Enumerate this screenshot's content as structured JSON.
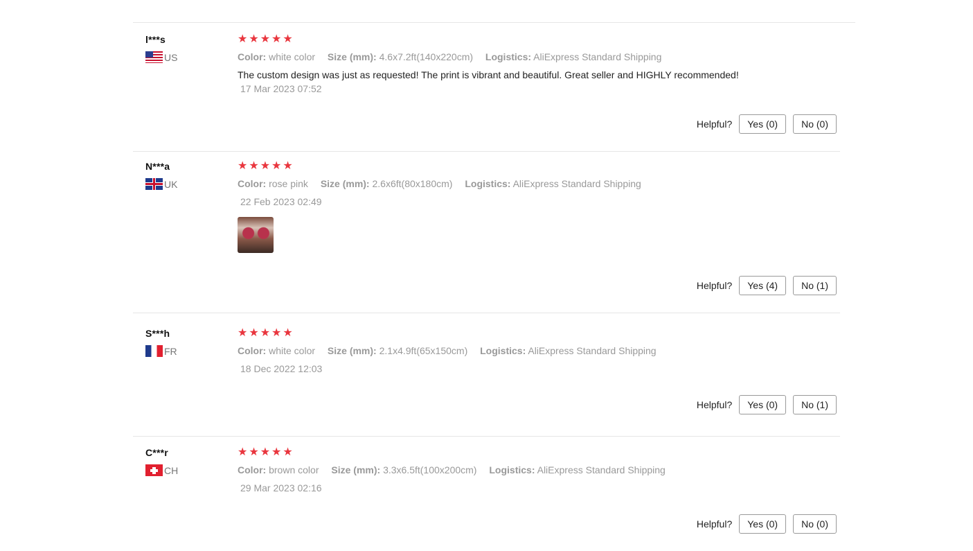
{
  "labels": {
    "color": "Color:",
    "size": "Size (mm):",
    "logistics": "Logistics:",
    "helpful": "Helpful?"
  },
  "colors": {
    "star": "#e9363e",
    "divider": "#e6e6e6"
  },
  "rating_max": 5,
  "reviews": [
    {
      "user": "l***s",
      "country": "US",
      "flag_icon": "us-flag-icon",
      "stars": 5,
      "color_value": "white color",
      "size_value": "4.6x7.2ft(140x220cm)",
      "logistics_value": "AliExpress Standard Shipping",
      "text": "The custom design was just as requested! The print is vibrant and beautiful. Great seller and HIGHLY recommended!",
      "date": "17 Mar 2023 07:52",
      "yes_label": "Yes (0)",
      "no_label": "No (0)"
    },
    {
      "user": "N***a",
      "country": "UK",
      "flag_icon": "uk-flag-icon",
      "stars": 5,
      "color_value": "rose pink",
      "size_value": "2.6x6ft(80x180cm)",
      "logistics_value": "AliExpress Standard Shipping",
      "date": "22 Feb 2023 02:49",
      "has_photo": true,
      "yes_label": "Yes (4)",
      "no_label": "No (1)"
    },
    {
      "user": "S***h",
      "country": "FR",
      "flag_icon": "fr-flag-icon",
      "stars": 5,
      "color_value": "white color",
      "size_value": "2.1x4.9ft(65x150cm)",
      "logistics_value": "AliExpress Standard Shipping",
      "date": "18 Dec 2022 12:03",
      "yes_label": "Yes (0)",
      "no_label": "No (1)"
    },
    {
      "user": "C***r",
      "country": "CH",
      "flag_icon": "ch-flag-icon",
      "stars": 5,
      "color_value": "brown color",
      "size_value": "3.3x6.5ft(100x200cm)",
      "logistics_value": "AliExpress Standard Shipping",
      "date": "29 Mar 2023 02:16",
      "yes_label": "Yes (0)",
      "no_label": "No (0)"
    }
  ]
}
